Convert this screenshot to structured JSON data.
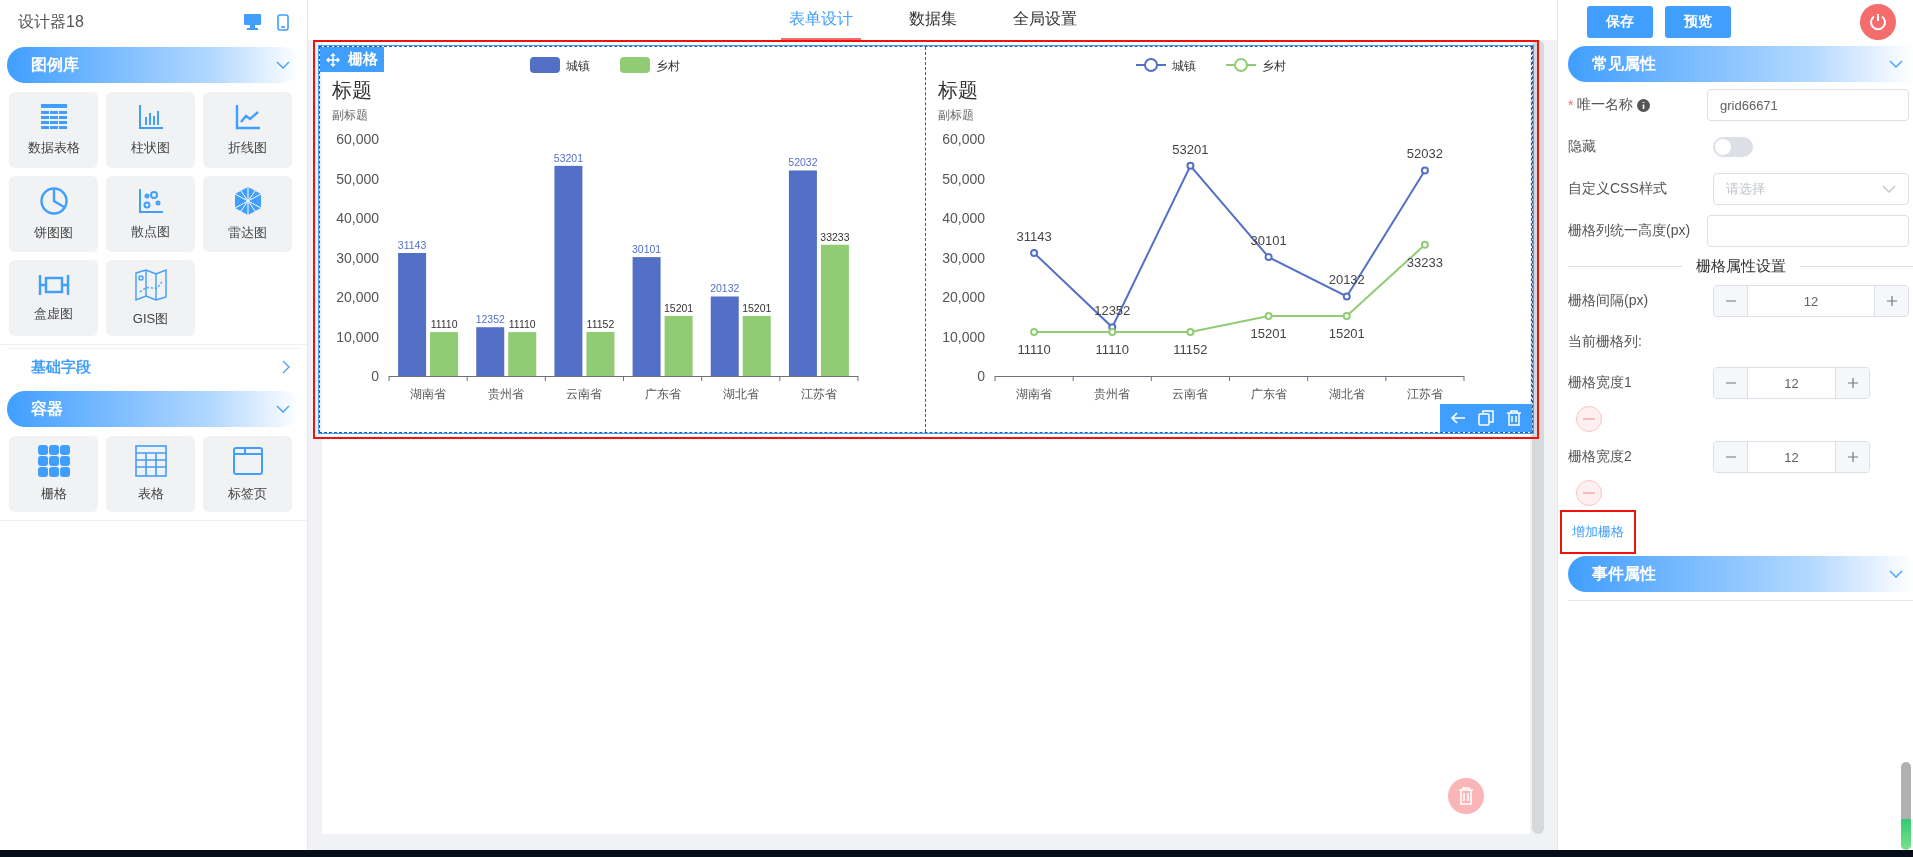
{
  "app": {
    "title": "设计器18"
  },
  "top_tabs": [
    {
      "label": "表单设计",
      "selected": true
    },
    {
      "label": "数据集",
      "selected": false
    },
    {
      "label": "全局设置",
      "selected": false
    }
  ],
  "toolbar_buttons": [
    "保存",
    "预览"
  ],
  "sidebar": {
    "sections": [
      {
        "title": "图例库",
        "expanded": true,
        "items": [
          "数据表格",
          "柱状图",
          "折线图",
          "饼图图",
          "散点图",
          "雷达图",
          "盒虚图",
          "GIS图"
        ]
      },
      {
        "title": "基础字段",
        "expanded": false
      },
      {
        "title": "容器",
        "expanded": true,
        "items": [
          "栅格",
          "表格",
          "标签页"
        ]
      }
    ]
  },
  "canvas": {
    "grid": {
      "label": "栅格",
      "highlighted": true,
      "columns": [
        {
          "title": "标题",
          "subtitle": "副标题",
          "chart_data": {
            "type": "bar",
            "legend": "top",
            "categories": [
              "湖南省",
              "贵州省",
              "云南省",
              "广东省",
              "湖北省",
              "江苏省"
            ],
            "ylim": [
              0,
              60000
            ],
            "yticks": [
              {
                "value": 0,
                "label": "0"
              },
              {
                "value": 10000,
                "label": "10,000"
              },
              {
                "value": 20000,
                "label": "20,000"
              },
              {
                "value": 30000,
                "label": "30,000"
              },
              {
                "value": 40000,
                "label": "40,000"
              },
              {
                "value": 50000,
                "label": "50,000"
              },
              {
                "value": 60000,
                "label": "60,000"
              }
            ],
            "data_labels": true,
            "series": [
              {
                "name": "城镇",
                "color": "#5470c6",
                "values": [
                  31143,
                  12352,
                  53201,
                  30101,
                  20132,
                  52032
                ]
              },
              {
                "name": "乡村",
                "color": "#91cc75",
                "values": [
                  11110,
                  11110,
                  11152,
                  15201,
                  15201,
                  33233
                ]
              }
            ]
          }
        },
        {
          "title": "标题",
          "subtitle": "副标题",
          "chart_data": {
            "type": "line",
            "legend": "top",
            "categories": [
              "湖南省",
              "贵州省",
              "云南省",
              "广东省",
              "湖北省",
              "江苏省"
            ],
            "ylim": [
              0,
              60000
            ],
            "yticks": [
              {
                "value": 0,
                "label": "0"
              },
              {
                "value": 10000,
                "label": "10,000"
              },
              {
                "value": 20000,
                "label": "20,000"
              },
              {
                "value": 30000,
                "label": "30,000"
              },
              {
                "value": 40000,
                "label": "40,000"
              },
              {
                "value": 50000,
                "label": "50,000"
              },
              {
                "value": 60000,
                "label": "60,000"
              }
            ],
            "data_labels": true,
            "series": [
              {
                "name": "城镇",
                "color": "#5470c6",
                "marker": true,
                "values": [
                  31143,
                  12352,
                  53201,
                  30101,
                  20132,
                  52032
                ]
              },
              {
                "name": "乡村",
                "color": "#91cc75",
                "marker": true,
                "values": [
                  11110,
                  11110,
                  11152,
                  15201,
                  15201,
                  33233
                ]
              }
            ]
          }
        }
      ]
    }
  },
  "properties": {
    "sections": [
      {
        "title": "常见属性"
      },
      {
        "title": "事件属性"
      }
    ],
    "fields": [
      {
        "kind": "input",
        "label": "唯一名称",
        "required_mark": "*",
        "info": true,
        "value": "grid66671"
      },
      {
        "kind": "switch",
        "label": "隐藏",
        "on": false
      },
      {
        "kind": "select",
        "label": "自定义CSS样式",
        "placeholder": "请选择"
      },
      {
        "kind": "input",
        "label": "栅格列统一高度(px)"
      }
    ],
    "divider": "栅格属性设置",
    "gutter": {
      "label": "栅格间隔(px)",
      "value": "12"
    },
    "columns_label": "当前栅格列:",
    "columns": [
      {
        "label": "栅格宽度1",
        "value": "12"
      },
      {
        "label": "栅格宽度2",
        "value": "12"
      }
    ],
    "add_link": {
      "label": "增加栅格",
      "highlighted": true
    }
  }
}
